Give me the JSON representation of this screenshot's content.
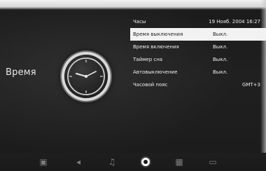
{
  "section": {
    "title": "Время"
  },
  "menu": {
    "rows": [
      {
        "label": "Часы",
        "value": "19 Нояб. 2004 16:27"
      },
      {
        "label": "Время выключения",
        "value": "Выкл."
      },
      {
        "label": "Время включения",
        "value": "Выкл."
      },
      {
        "label": "Таймер сна",
        "value": "Выкл."
      },
      {
        "label": "Автовыключение",
        "value": "Выкл."
      },
      {
        "label": "Часовой пояс",
        "value": "GMT+3"
      }
    ]
  },
  "bottom_tabs": [
    {
      "icon": "picture-icon",
      "state": "inactive"
    },
    {
      "icon": "sound-icon",
      "state": "inactive"
    },
    {
      "icon": "music-icon",
      "state": "inactive"
    },
    {
      "icon": "clock-icon",
      "state": "active"
    },
    {
      "icon": "settings-icon",
      "state": "inactive"
    },
    {
      "icon": "lock-icon",
      "state": "inactive"
    }
  ],
  "colors": {
    "background": "#1b1b1b",
    "text": "#efefef",
    "selected_row": "#f2f2f2",
    "inactive_icon": "#7b7b7b"
  }
}
